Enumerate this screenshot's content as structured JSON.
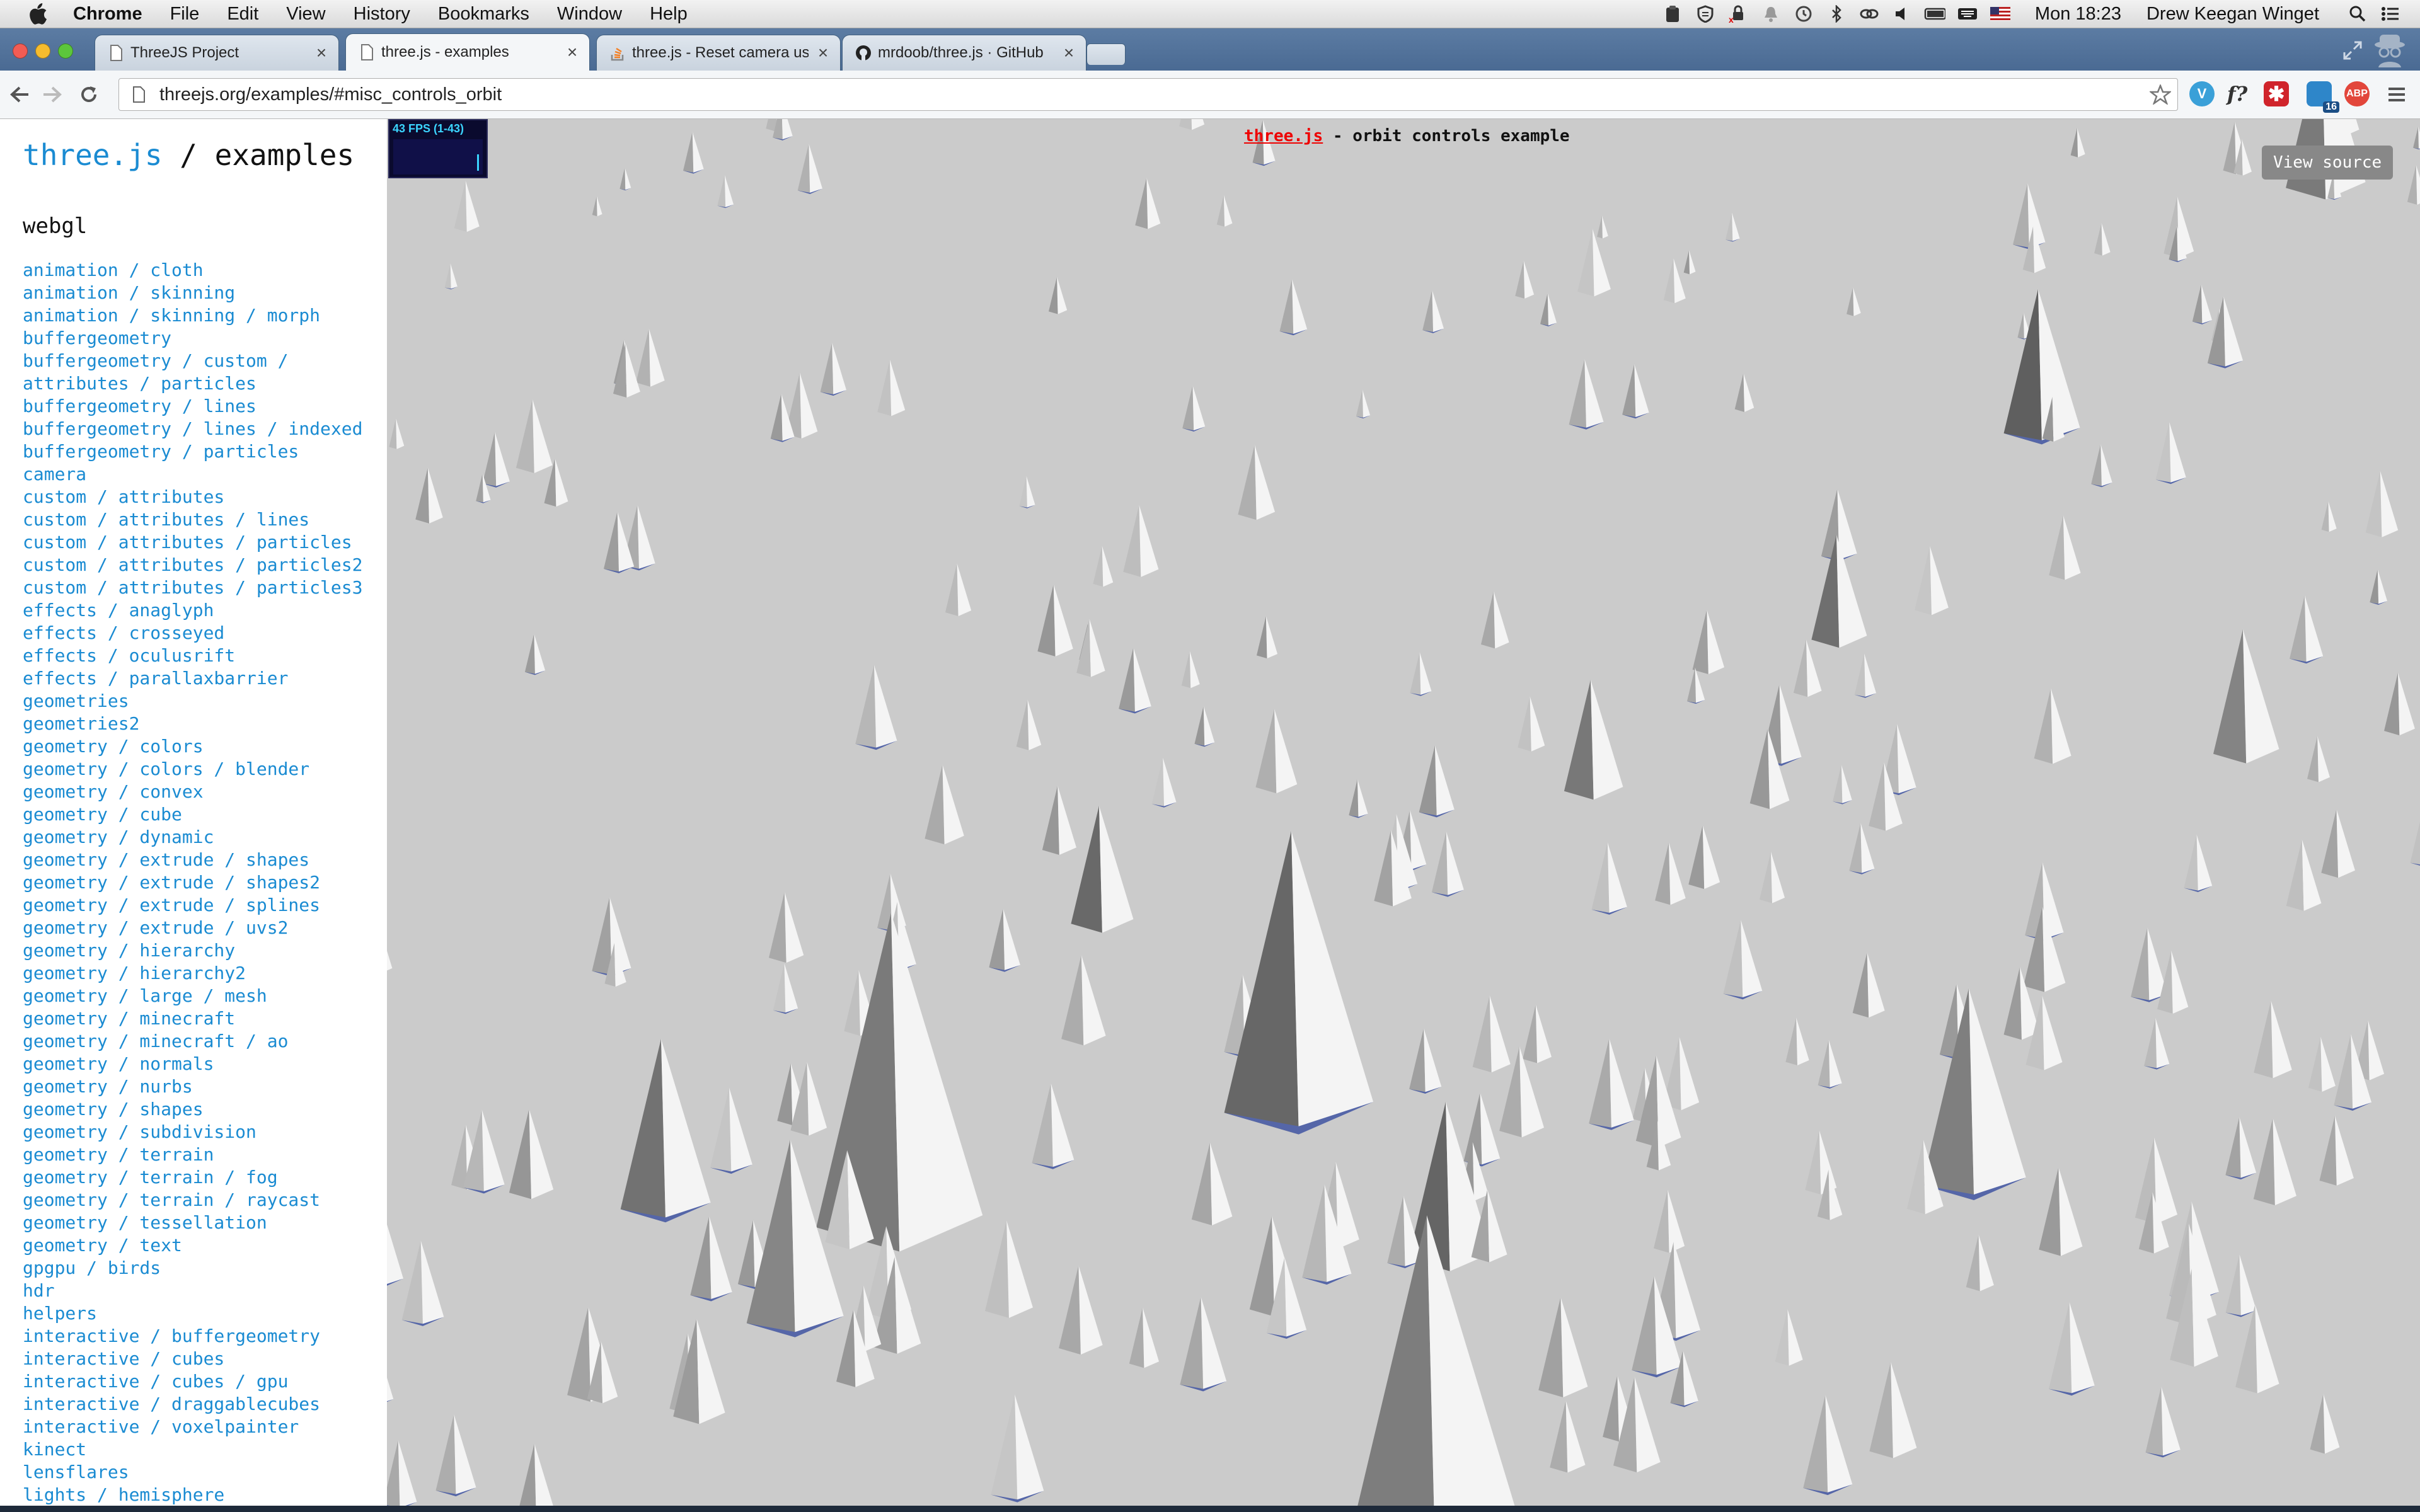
{
  "menubar": {
    "app": "Chrome",
    "items": [
      "File",
      "Edit",
      "View",
      "History",
      "Bookmarks",
      "Window",
      "Help"
    ],
    "clock": "Mon 18:23",
    "user": "Drew Keegan Winget"
  },
  "tabs": [
    {
      "title": "ThreeJS Project",
      "active": false
    },
    {
      "title": "three.js - examples",
      "active": true
    },
    {
      "title": "three.js - Reset camera us",
      "active": false
    },
    {
      "title": "mrdoob/three.js · GitHub",
      "active": false
    }
  ],
  "toolbar": {
    "url": "threejs.org/examples/#misc_controls_orbit",
    "ext_badge": "16"
  },
  "sidebar": {
    "brand": "three.js",
    "title_rest": " / examples",
    "section": "webgl",
    "items": [
      "animation / cloth",
      "animation / skinning",
      "animation / skinning / morph",
      "buffergeometry",
      "buffergeometry / custom /",
      "attributes / particles",
      "buffergeometry / lines",
      "buffergeometry / lines / indexed",
      "buffergeometry / particles",
      "camera",
      "custom / attributes",
      "custom / attributes / lines",
      "custom / attributes / particles",
      "custom / attributes / particles2",
      "custom / attributes / particles3",
      "effects / anaglyph",
      "effects / crosseyed",
      "effects / oculusrift",
      "effects / parallaxbarrier",
      "geometries",
      "geometries2",
      "geometry / colors",
      "geometry / colors / blender",
      "geometry / convex",
      "geometry / cube",
      "geometry / dynamic",
      "geometry / extrude / shapes",
      "geometry / extrude / shapes2",
      "geometry / extrude / splines",
      "geometry / extrude / uvs2",
      "geometry / hierarchy",
      "geometry / hierarchy2",
      "geometry / large / mesh",
      "geometry / minecraft",
      "geometry / minecraft / ao",
      "geometry / normals",
      "geometry / nurbs",
      "geometry / shapes",
      "geometry / subdivision",
      "geometry / terrain",
      "geometry / terrain / fog",
      "geometry / terrain / raycast",
      "geometry / tessellation",
      "geometry / text",
      "gpgpu / birds",
      "hdr",
      "helpers",
      "interactive / buffergeometry",
      "interactive / cubes",
      "interactive / cubes / gpu",
      "interactive / draggablecubes",
      "interactive / voxelpainter",
      "kinect",
      "lensflares",
      "lights / hemisphere"
    ]
  },
  "viewport": {
    "stats": "43 FPS (1-43)",
    "info_link": "three.js",
    "info_rest": " - orbit controls example",
    "view_source": "View source"
  }
}
